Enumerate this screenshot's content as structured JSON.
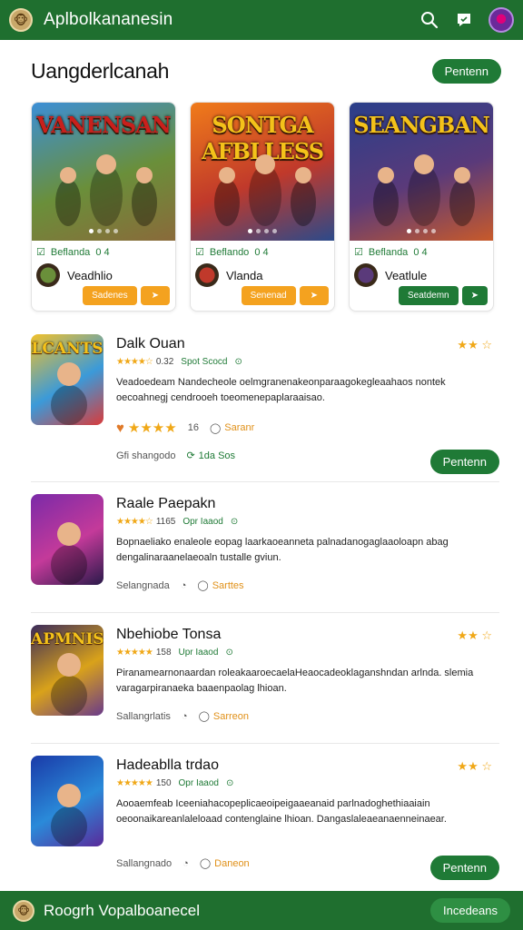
{
  "app": {
    "title": "Aplbolkananesin",
    "logo_icon": "monkey-logo-icon"
  },
  "topbar": {
    "search_icon": "search-icon",
    "messages_icon": "chat-icon",
    "avatar_icon": "profile-avatar"
  },
  "section": {
    "title": "Uangderlcanah",
    "action_label": "Pentenn"
  },
  "featured": [
    {
      "banner_title": "VANENSAN",
      "title_color": "#c8201c",
      "badge": "Beflanda",
      "rating": "0 4",
      "developer": "Veadhlio",
      "primary_label": "Sadenes",
      "secondary_label": "➤",
      "colors": [
        "#3c8fd6",
        "#6a8f3a",
        "#8a6a3a"
      ]
    },
    {
      "banner_title": "SONTGA AFBLLESS",
      "title_color": "#f4c21a",
      "badge": "Beflando",
      "rating": "0 4",
      "developer": "Vlanda",
      "primary_label": "Senenad",
      "secondary_label": "➤",
      "colors": [
        "#f07b1a",
        "#c0392b",
        "#2c4a8a"
      ]
    },
    {
      "banner_title": "SEANGBAN",
      "title_color": "#f4c21a",
      "badge": "Beflanda",
      "rating": "0 4",
      "developer": "Veatlule",
      "primary_label": "Seatdemn",
      "secondary_label": "➤",
      "colors": [
        "#2a3f8a",
        "#5a3a7a",
        "#c85a2a"
      ]
    }
  ],
  "apps": [
    {
      "name": "Dalk Ouan",
      "rating_stars": "★★★★☆",
      "rating_value": "0.32",
      "size_text": "Spot Scocd",
      "desc": "Veadoedeam Nandecheole oelmgranenakeonparaagokegleaahaos nontek oecoahnegj cendrooeh toeomenepaplaraaisao.",
      "reactions": "★★★★",
      "reaction_count": "16",
      "comment_label": "Saranr",
      "footer_left": "Gfi shangodo",
      "footer_right": "1da Sos",
      "corner_stars": "★★ ☆",
      "install_label": "Pentenn",
      "thumb_title": "LCANTS",
      "colors": [
        "#f2c12a",
        "#3b9ad9",
        "#d93b3b"
      ]
    },
    {
      "name": "Raale Paepakn",
      "rating_stars": "★★★★☆",
      "rating_value": "1165",
      "size_text": "Opr Iaaod",
      "desc": "Bopnaeliako enaleole eopag laarkaoeanneta palnadanogaglaaoloapn abag dengalinaraanelaeoaln tustalle gviun.",
      "footer_left": "Selangnada",
      "comment_label": "Sarttes",
      "colors": [
        "#7a2aa8",
        "#c43a9a",
        "#2a1a4a"
      ]
    },
    {
      "name": "Nbehiobe Tonsa",
      "rating_stars": "★★★★★",
      "rating_value": "158",
      "size_text": "Upr Iaaod",
      "desc": "Piranamearnonaardan roleakaaroecaelaHeaocadeoklaganshndan arlnda. slemia varagarpiranaeka baaenpaolag lhioan.",
      "footer_left": "Sallangrlatis",
      "comment_label": "Sarreon",
      "corner_stars": "★★ ☆",
      "thumb_title": "APMNIS",
      "colors": [
        "#3a2a5a",
        "#d9a21a",
        "#6a3a8a"
      ]
    },
    {
      "name": "Hadeablla trdao",
      "rating_stars": "★★★★★",
      "rating_value": "150",
      "size_text": "Opr Iaaod",
      "desc": "Aooaemfeab Iceeniahacopeplicaeoipeigaaeanaid parlnadoghethiaaiain oeoonaikareanlaleloaad contenglaine lhioan. Dangaslaleaeanaenneinaear.",
      "footer_left": "Sallangnado",
      "comment_label": "Daneon",
      "corner_stars": "★★ ☆",
      "install_label": "Pentenn",
      "colors": [
        "#1a3aa8",
        "#2a8ad9",
        "#5a2a9a"
      ]
    }
  ],
  "bottombar": {
    "title": "Roogrh Vopalboanecel",
    "action_label": "Incedeans"
  }
}
